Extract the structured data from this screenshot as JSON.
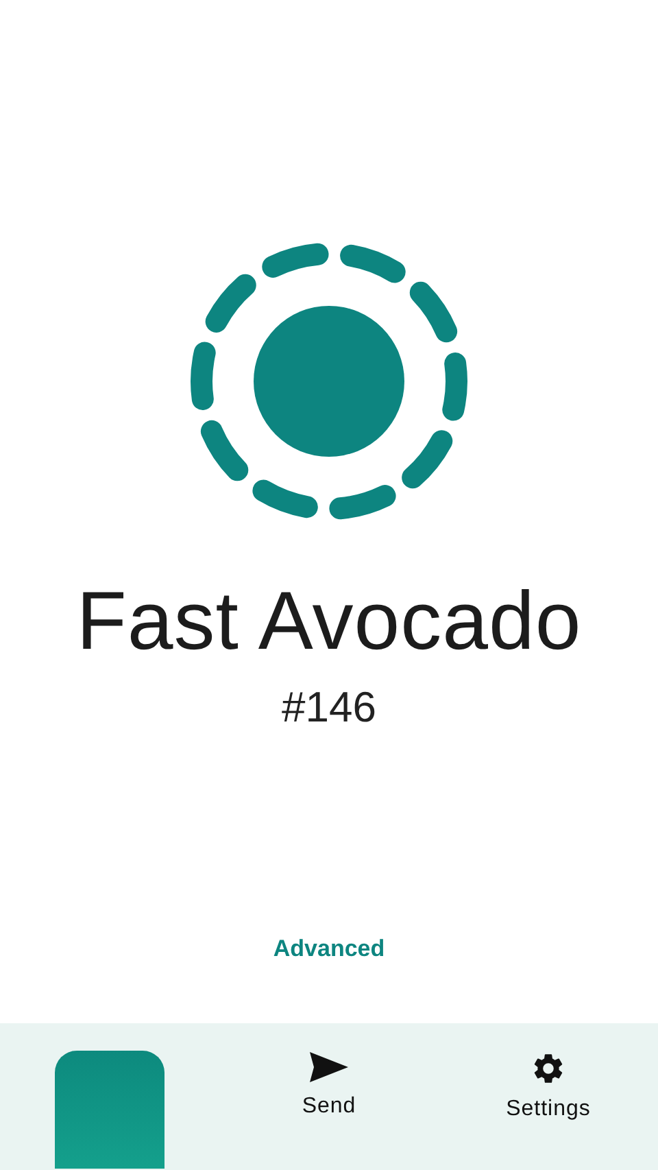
{
  "title": "Fast Avocado",
  "number": "#146",
  "advanced_link": "Advanced",
  "nav": [
    {
      "kind": "indicator",
      "selected": true
    },
    {
      "kind": "send",
      "label": "Send",
      "selected": false
    },
    {
      "kind": "settings",
      "label": "Settings",
      "selected": false
    }
  ]
}
